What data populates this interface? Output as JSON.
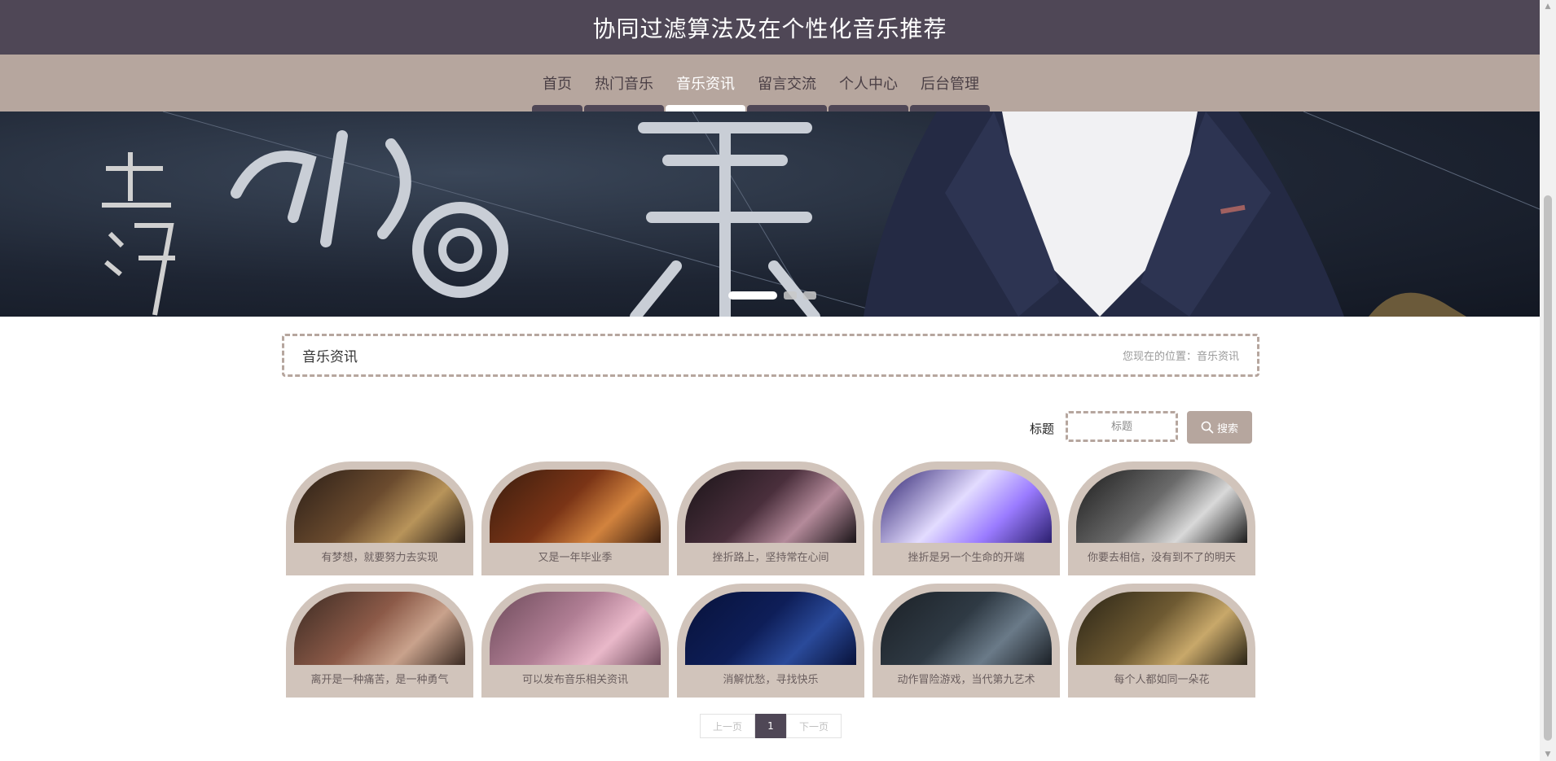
{
  "header": {
    "title": "协同过滤算法及在个性化音乐推荐"
  },
  "nav": {
    "items": [
      {
        "label": "首页",
        "active": false
      },
      {
        "label": "热门音乐",
        "active": false
      },
      {
        "label": "音乐资讯",
        "active": true
      },
      {
        "label": "留言交流",
        "active": false
      },
      {
        "label": "个人中心",
        "active": false
      },
      {
        "label": "后台管理",
        "active": false
      }
    ]
  },
  "banner": {
    "slide_count": 3,
    "active_index": 0
  },
  "breadcrumb": {
    "title": "音乐资讯",
    "location_prefix": "您现在的位置：",
    "location_link": "音乐资讯"
  },
  "search": {
    "label": "标题",
    "placeholder": "标题",
    "button_label": "搜索",
    "button_icon": "search-icon"
  },
  "news": {
    "items": [
      {
        "title": "有梦想，就要努力去实现",
        "colors": [
          "#2a1e17",
          "#b8945a",
          "#6b4b2e"
        ]
      },
      {
        "title": "又是一年毕业季",
        "colors": [
          "#3a1d0e",
          "#d2833e",
          "#7a3416"
        ]
      },
      {
        "title": "挫折路上，坚持常在心间",
        "colors": [
          "#1a1418",
          "#b48a9a",
          "#4a2f3c"
        ]
      },
      {
        "title": "挫折是另一个生命的开端",
        "colors": [
          "#2b1f6e",
          "#9a7bff",
          "#e3dcff"
        ]
      },
      {
        "title": "你要去相信，没有到不了的明天",
        "colors": [
          "#1c1c1c",
          "#d9d9d9",
          "#6a6a6a"
        ]
      },
      {
        "title": "离开是一种痛苦，是一种勇气",
        "colors": [
          "#3a2a22",
          "#c9a28c",
          "#8c5a48"
        ]
      },
      {
        "title": "可以发布音乐相关资讯",
        "colors": [
          "#6d4a5a",
          "#e9b8c9",
          "#b07e94"
        ]
      },
      {
        "title": "消解忧愁，寻找快乐",
        "colors": [
          "#08123a",
          "#2a4a9a",
          "#0e1e58"
        ]
      },
      {
        "title": "动作冒险游戏，当代第九艺术",
        "colors": [
          "#1b2026",
          "#6a7a88",
          "#2f3a44"
        ]
      },
      {
        "title": "每个人都如同一朵花",
        "colors": [
          "#2a2416",
          "#c8a86a",
          "#6e5a32"
        ]
      }
    ]
  },
  "pagination": {
    "prev_label": "上一页",
    "current": "1",
    "next_label": "下一页"
  },
  "colors": {
    "header_bg": "#4f4756",
    "nav_bg": "#b6a69e",
    "card_bg": "#d1c4bb",
    "accent": "#b6a69e"
  }
}
